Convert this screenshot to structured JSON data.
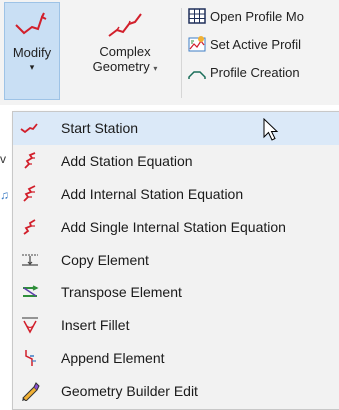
{
  "ribbon": {
    "modify": {
      "label": "Modify",
      "arrow": "▾"
    },
    "complex_geometry": {
      "label_line1": "Complex",
      "label_line2": "Geometry",
      "arrow": "▾"
    },
    "side_items": [
      {
        "label": "Open Profile Mo",
        "icon": "grid-table-icon"
      },
      {
        "label": "Set Active Profil",
        "icon": "set-active-profile-icon"
      },
      {
        "label": "Profile Creation",
        "icon": "profile-creation-icon"
      }
    ]
  },
  "menu": {
    "items": [
      {
        "label": "Start Station",
        "icon": "start-station-icon"
      },
      {
        "label": "Add Station Equation",
        "icon": "add-station-equation-icon"
      },
      {
        "label": "Add Internal Station Equation",
        "icon": "add-internal-station-equation-icon"
      },
      {
        "label": "Add Single Internal Station Equation",
        "icon": "add-single-internal-station-equation-icon"
      },
      {
        "label": "Copy Element",
        "icon": "copy-element-icon"
      },
      {
        "label": "Transpose Element",
        "icon": "transpose-element-icon"
      },
      {
        "label": "Insert Fillet",
        "icon": "insert-fillet-icon"
      },
      {
        "label": "Append Element",
        "icon": "append-element-icon"
      },
      {
        "label": "Geometry Builder Edit",
        "icon": "geometry-builder-edit-icon"
      }
    ],
    "highlighted_index": 0
  },
  "colors": {
    "accent_red": "#d21f2b",
    "highlight": "#dbe9f8",
    "pressed": "#c9dff4"
  }
}
